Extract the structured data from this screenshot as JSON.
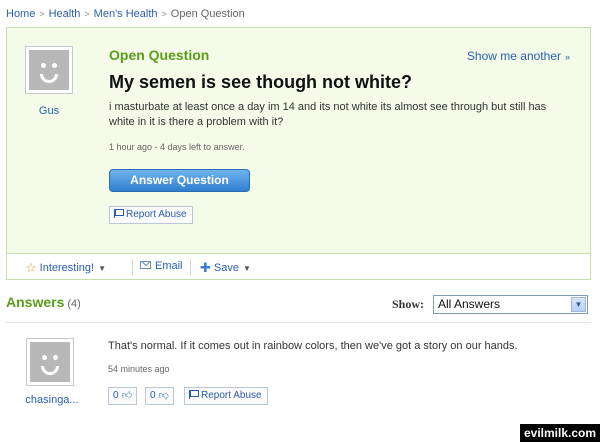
{
  "breadcrumb": {
    "items": [
      "Home",
      "Health",
      "Men's Health"
    ],
    "current": "Open Question"
  },
  "question": {
    "status": "Open Question",
    "show_another": "Show me another",
    "title": "My semen is see though not white?",
    "body": "i masturbate at least once a day im 14 and its not white its almost see through but still has white in it is there a problem with it?",
    "meta": "1 hour ago - 4 days left to answer.",
    "asker": "Gus",
    "answer_button": "Answer Question",
    "report_button": "Report Abuse"
  },
  "actions": {
    "interesting": "Interesting!",
    "email": "Email",
    "save": "Save"
  },
  "answers": {
    "heading": "Answers",
    "count": "(4)",
    "show_label": "Show:",
    "show_value": "All Answers",
    "items": [
      {
        "text": "That's normal. If it comes out in rainbow colors, then we've got a story on our hands.",
        "meta": "54 minutes ago",
        "author": "chasinga...",
        "thumbs_up": "0",
        "thumbs_down": "0",
        "report": "Report Abuse"
      }
    ]
  },
  "watermark": "evilmilk.com",
  "icons": {
    "breadcrumb_sep": "chevron-right-icon",
    "interesting": "star-icon",
    "email": "envelope-icon",
    "save": "plus-icon",
    "report": "flag-icon",
    "vote_up": "thumb-up-icon",
    "vote_down": "thumb-down-icon",
    "dropdown": "chevron-down-icon"
  },
  "colors": {
    "accent_green": "#5a9d1a",
    "link_blue": "#2a5db0",
    "question_bg": "#f4fbe8",
    "button_blue": "#2f7fd0"
  }
}
